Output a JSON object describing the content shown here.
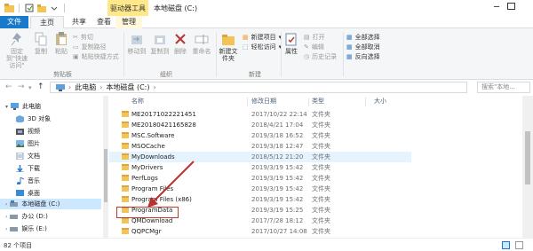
{
  "window": {
    "title": "本地磁盘 (C:)",
    "tool_tab": "驱动器工具"
  },
  "tabs": {
    "file": "文件",
    "home": "主页",
    "share": "共享",
    "view": "查看",
    "manage": "管理"
  },
  "ribbon": {
    "pin_label": "固定到\"快速访问\"",
    "copy_label": "复制",
    "paste_label": "粘贴",
    "cut_label": "剪切",
    "copy_path_label": "复制路径",
    "paste_shortcut_label": "粘贴快捷方式",
    "clipboard_group": "剪贴板",
    "move_to_label": "移动到",
    "copy_to_label": "复制到",
    "delete_label": "删除",
    "rename_label": "重命名",
    "organize_group": "组织",
    "new_folder_label": "新建文件夹",
    "new_item_label": "新建项目",
    "easy_access_label": "轻松访问",
    "new_group": "新建",
    "properties_label": "属性",
    "open_label": "打开",
    "edit_label": "编辑",
    "history_label": "历史记录",
    "select_all_label": "全部选择",
    "select_none_label": "全部取消",
    "invert_label": "反向选择"
  },
  "address": {
    "crumb1": "此电脑",
    "crumb2": "本地磁盘 (C:)",
    "search_placeholder": "搜索\"本地..."
  },
  "nav_pane": {
    "items": [
      {
        "label": "此电脑"
      },
      {
        "label": "3D 对象"
      },
      {
        "label": "视频"
      },
      {
        "label": "图片"
      },
      {
        "label": "文档"
      },
      {
        "label": "下载"
      },
      {
        "label": "音乐"
      },
      {
        "label": "桌面"
      },
      {
        "label": "本地磁盘 (C:)"
      },
      {
        "label": "办公 (D:)"
      },
      {
        "label": "娱乐 (E:)"
      }
    ]
  },
  "columns": {
    "name": "名称",
    "date": "修改日期",
    "type": "类型",
    "size": "大小"
  },
  "files": [
    {
      "name": "ME20171022221451",
      "date": "2017/10/22 22:14",
      "type": "文件夹"
    },
    {
      "name": "ME20180421165828",
      "date": "2018/4/21 17:04",
      "type": "文件夹"
    },
    {
      "name": "MSC.Software",
      "date": "2019/3/18 16:52",
      "type": "文件夹"
    },
    {
      "name": "MSOCache",
      "date": "2019/3/18 12:47",
      "type": "文件夹"
    },
    {
      "name": "MyDownloads",
      "date": "2018/5/12 21:20",
      "type": "文件夹"
    },
    {
      "name": "MyDrivers",
      "date": "2019/3/19 15:42",
      "type": "文件夹"
    },
    {
      "name": "PerfLogs",
      "date": "2019/3/19 15:42",
      "type": "文件夹"
    },
    {
      "name": "Program Files",
      "date": "2019/3/19 15:42",
      "type": "文件夹"
    },
    {
      "name": "Program Files (x86)",
      "date": "2019/3/19 15:42",
      "type": "文件夹"
    },
    {
      "name": "ProgramData",
      "date": "2019/3/19 15:25",
      "type": "文件夹"
    },
    {
      "name": "QMDownload",
      "date": "2017/7/28 18:12",
      "type": "文件夹"
    },
    {
      "name": "QQPCMgr",
      "date": "2017/10/27 14:08",
      "type": "文件夹"
    }
  ],
  "status": {
    "count": "82 个项目"
  },
  "colors": {
    "file_tab": "#1979ca",
    "tool_tab": "#ffe88a",
    "selection": "#cce8ff",
    "highlight_box": "#c0392b"
  }
}
